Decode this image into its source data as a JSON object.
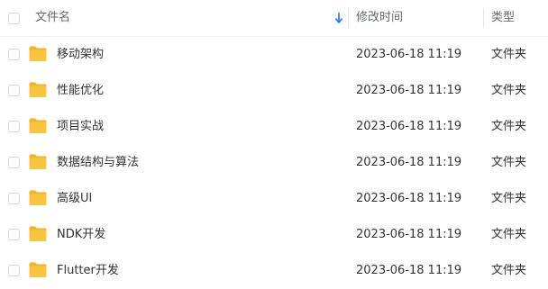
{
  "table": {
    "headers": {
      "name": "文件名",
      "modified": "修改时间",
      "type": "类型"
    },
    "sort_icon": "arrow-down-sort-icon",
    "accent_color": "#1a7af8",
    "folder_color": "#f9c53d",
    "rows": [
      {
        "name": "移动架构",
        "modified": "2023-06-18 11:19",
        "type": "文件夹"
      },
      {
        "name": "性能优化",
        "modified": "2023-06-18 11:19",
        "type": "文件夹"
      },
      {
        "name": "项目实战",
        "modified": "2023-06-18 11:19",
        "type": "文件夹"
      },
      {
        "name": "数据结构与算法",
        "modified": "2023-06-18 11:19",
        "type": "文件夹"
      },
      {
        "name": "高级UI",
        "modified": "2023-06-18 11:19",
        "type": "文件夹"
      },
      {
        "name": "NDK开发",
        "modified": "2023-06-18 11:19",
        "type": "文件夹"
      },
      {
        "name": "Flutter开发",
        "modified": "2023-06-18 11:19",
        "type": "文件夹"
      }
    ]
  }
}
